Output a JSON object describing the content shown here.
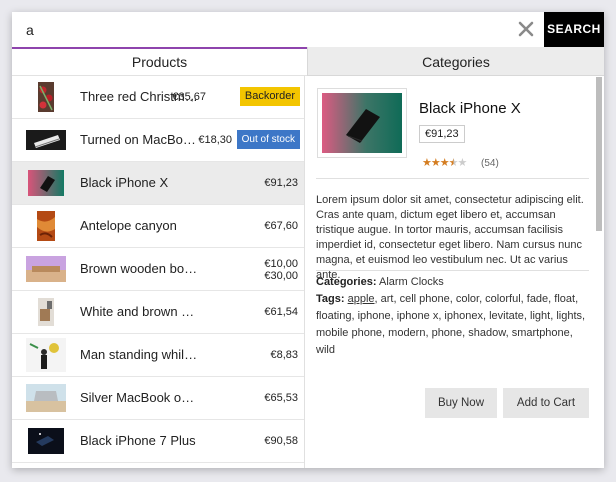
{
  "search": {
    "value": "a",
    "placeholder": "",
    "button_label": "SEARCH"
  },
  "tabs": {
    "products": "Products",
    "categories": "Categories"
  },
  "results": [
    {
      "title": "Three red Christmas decorations",
      "price": "€35,67",
      "badge": "Backorder"
    },
    {
      "title": "Turned on MacBook Pro",
      "price": "€18,30",
      "badge": "Out of stock"
    },
    {
      "title": "Black iPhone X",
      "price": "€91,23"
    },
    {
      "title": "Antelope canyon",
      "price": "€67,60"
    },
    {
      "title": "Brown wooden board",
      "price": "€10,00",
      "price_max": "€30,00"
    },
    {
      "title": "White and brown wooden counter",
      "price": "€61,54"
    },
    {
      "title": "Man standing while looking on wall",
      "price": "€8,83"
    },
    {
      "title": "Silver MacBook on beige table",
      "price": "€65,53"
    },
    {
      "title": "Black iPhone 7 Plus",
      "price": "€90,58"
    }
  ],
  "detail": {
    "title": "Black iPhone X",
    "price": "€91,23",
    "rating": 3.5,
    "review_count": "(54)",
    "description": "Lorem ipsum dolor sit amet, consectetur adipiscing elit. Cras ante quam, dictum eget libero et, accumsan tristique augue. In tortor mauris, accumsan facilisis imperdiet id, consectetur eget libero. Nam cursus nunc magna, et euismod leo vestibulum nec. Ut ac varius ante.",
    "categories_label": "Categories:",
    "categories": "Alarm Clocks",
    "tags_label": "Tags:",
    "tags_first": "apple",
    "tags_rest": ", art, cell phone, color, colorful, fade, float, floating, iphone, iphone x, iphonex, levitate, light, lights, mobile phone, modern, phone, shadow, smartphone, wild",
    "buy_label": "Buy Now",
    "cart_label": "Add to Cart"
  },
  "colors": {
    "accent_tab": "#8e44ad",
    "backorder": "#f3c500",
    "out_of_stock": "#3d77c7",
    "star": "#d47d21"
  },
  "icons": {
    "clear": "close-icon"
  }
}
